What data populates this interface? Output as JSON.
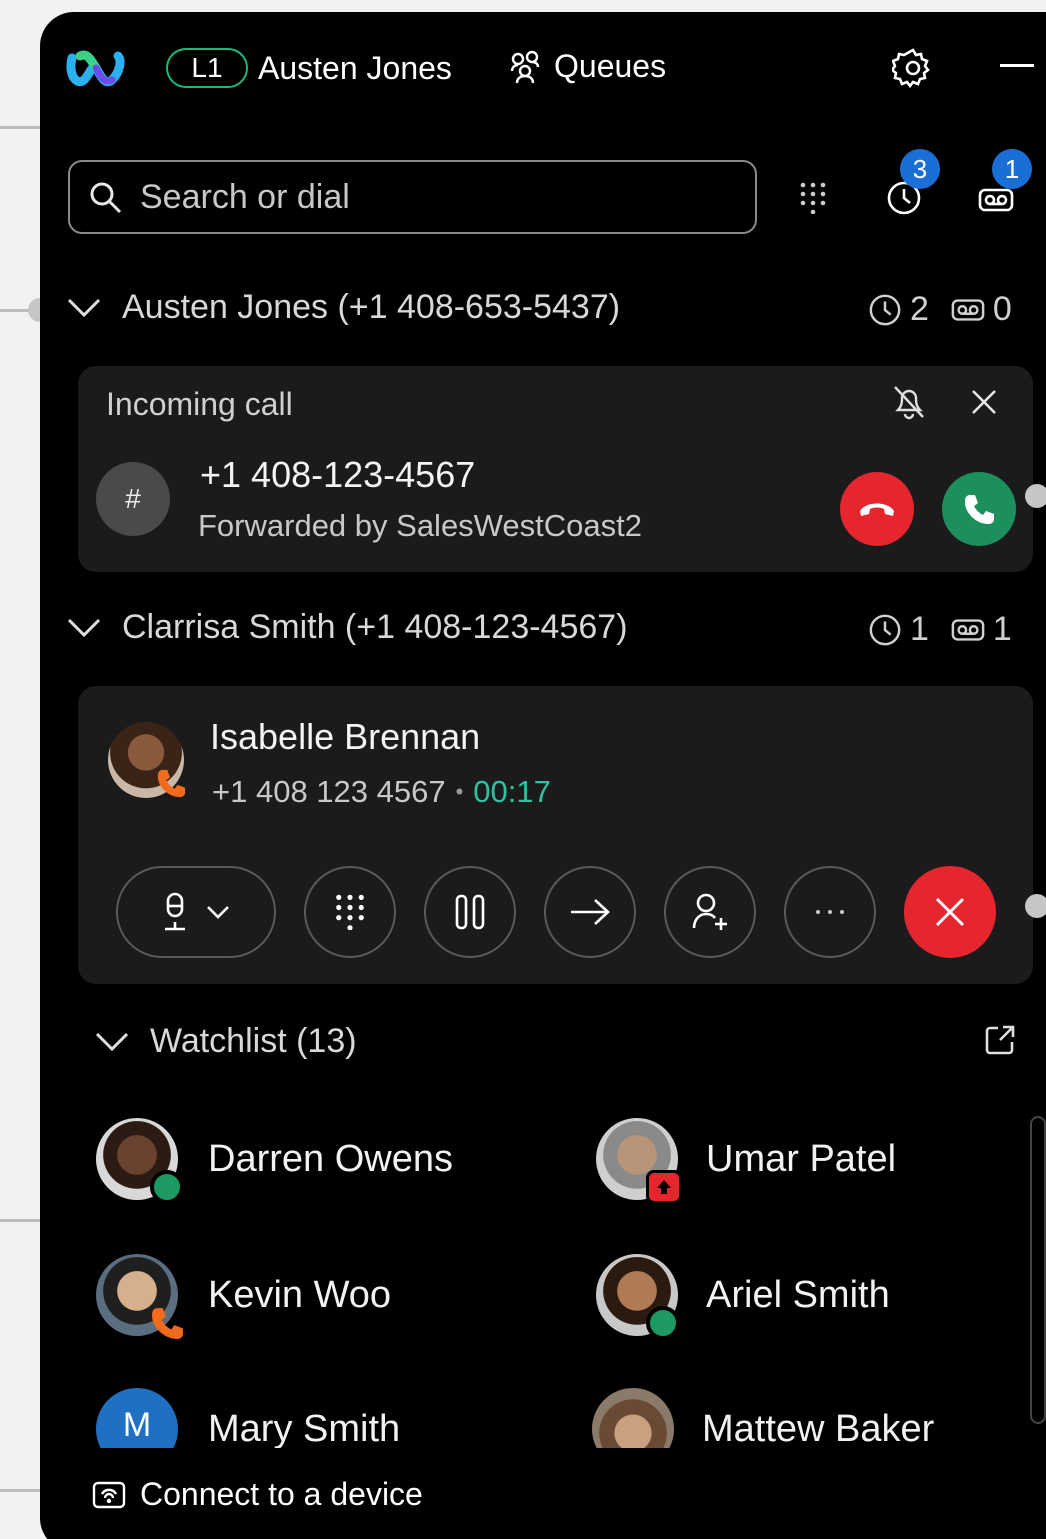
{
  "topbar": {
    "line_badge": "L1",
    "user_name": "Austen Jones",
    "queues_label": "Queues",
    "icons": [
      "webex-logo",
      "queues-icon",
      "settings-icon",
      "minimize-icon"
    ]
  },
  "search": {
    "placeholder": "Search or dial",
    "history_badge": "3",
    "voicemail_badge": "1"
  },
  "line1": {
    "header": "Austen Jones (+1 408-653-5437)",
    "history_count": "2",
    "voicemail_count": "0"
  },
  "incoming_call": {
    "title": "Incoming call",
    "avatar_glyph": "#",
    "number": "+1 408-123-4567",
    "forwarded": "Forwarded by SalesWestCoast2"
  },
  "line2": {
    "header": "Clarrisa Smith (+1 408-123-4567)",
    "history_count": "1",
    "voicemail_count": "1"
  },
  "active_call": {
    "name": "Isabelle Brennan",
    "number": "+1 408 123 4567",
    "separator": "•",
    "duration": "00:17",
    "controls": [
      "microphone",
      "keypad",
      "hold",
      "transfer",
      "add-participant",
      "more",
      "end-call"
    ]
  },
  "watchlist": {
    "title": "Watchlist (13)",
    "contacts": [
      {
        "name": "Darren Owens",
        "status": "available"
      },
      {
        "name": "Umar Patel",
        "status": "presenting"
      },
      {
        "name": "Kevin Woo",
        "status": "on-call"
      },
      {
        "name": "Ariel Smith",
        "status": "available"
      },
      {
        "name": "Mary Smith",
        "initial": "M",
        "status": ""
      },
      {
        "name": "Mattew Baker",
        "status": ""
      }
    ]
  },
  "footer": {
    "connect_label": "Connect to a device"
  },
  "colors": {
    "accent_green": "#1db97a",
    "decline_red": "#e5262f",
    "answer_green": "#1c8f5c",
    "badge_blue": "#1a6fd6",
    "timer_teal": "#2fc2a0"
  }
}
